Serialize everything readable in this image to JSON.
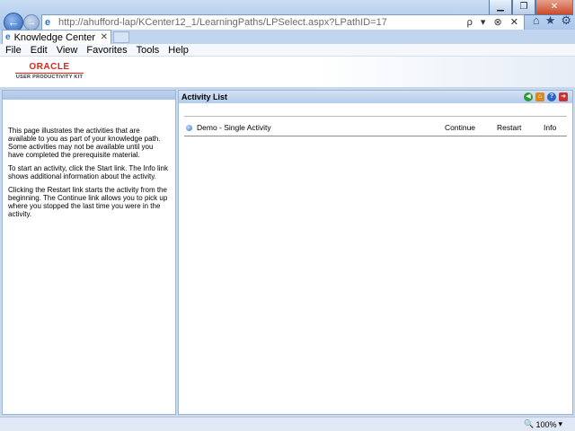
{
  "browser": {
    "address_host": "http://ahufford-lap",
    "address_path": "/KCenter12_1/LearningPaths/LPSelect.aspx?LPathID=17",
    "address_tools": "ρ ▾ ⊗ ✕",
    "tab_title": "Knowledge Center",
    "menu": [
      "File",
      "Edit",
      "View",
      "Favorites",
      "Tools",
      "Help"
    ],
    "zoom": "100%"
  },
  "logo": {
    "brand": "ORACLE",
    "product": "USER PRODUCTIVITY KIT"
  },
  "left_panel": {
    "paragraphs": [
      "This page illustrates the activities that are available to you as part of your knowledge path. Some activities may not be available until you have completed the prerequisite material.",
      "To start an activity, click the Start link. The Info link shows additional information about the activity.",
      "Clicking the Restart link starts the activity from the beginning. The Continue link allows you to pick up where you stopped the last time you were in the activity."
    ]
  },
  "activity_list": {
    "title": "Activity List",
    "items": [
      {
        "name": "Demo - Single Activity",
        "continue": "Continue",
        "restart": "Restart",
        "info": "Info"
      }
    ]
  }
}
